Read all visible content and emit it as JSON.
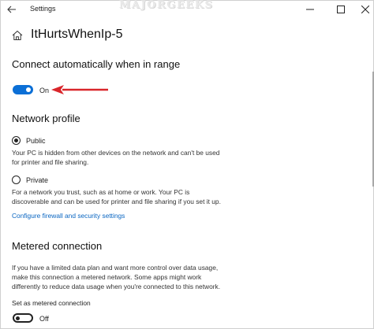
{
  "window": {
    "title": "Settings",
    "watermark": "MAJORGEEKS"
  },
  "header": {
    "title": "ItHurtsWhenIp-5"
  },
  "auto_connect": {
    "heading": "Connect automatically when in range",
    "toggle_state": "On",
    "toggle_on": true
  },
  "network_profile": {
    "heading": "Network profile",
    "public_label": "Public",
    "public_selected": true,
    "public_desc_line1": "Your PC is hidden from other devices on the network and can't be used",
    "public_desc_line2": "for printer and file sharing.",
    "private_label": "Private",
    "private_selected": false,
    "private_desc_line1": "For a network you trust, such as at home or work. Your PC is",
    "private_desc_line2": "discoverable and can be used for printer and file sharing if you set it up.",
    "firewall_link": "Configure firewall and security settings"
  },
  "metered": {
    "heading": "Metered connection",
    "desc_line1": "If you have a limited data plan and want more control over data usage,",
    "desc_line2": "make this connection a metered network. Some apps might work",
    "desc_line3": "differently to reduce data usage when you're connected to this network.",
    "set_label": "Set as metered connection",
    "toggle_state": "Off",
    "toggle_on": false
  },
  "colors": {
    "accent": "#0b6fd6",
    "link": "#0a66c2",
    "annotation_arrow": "#d9262b"
  }
}
